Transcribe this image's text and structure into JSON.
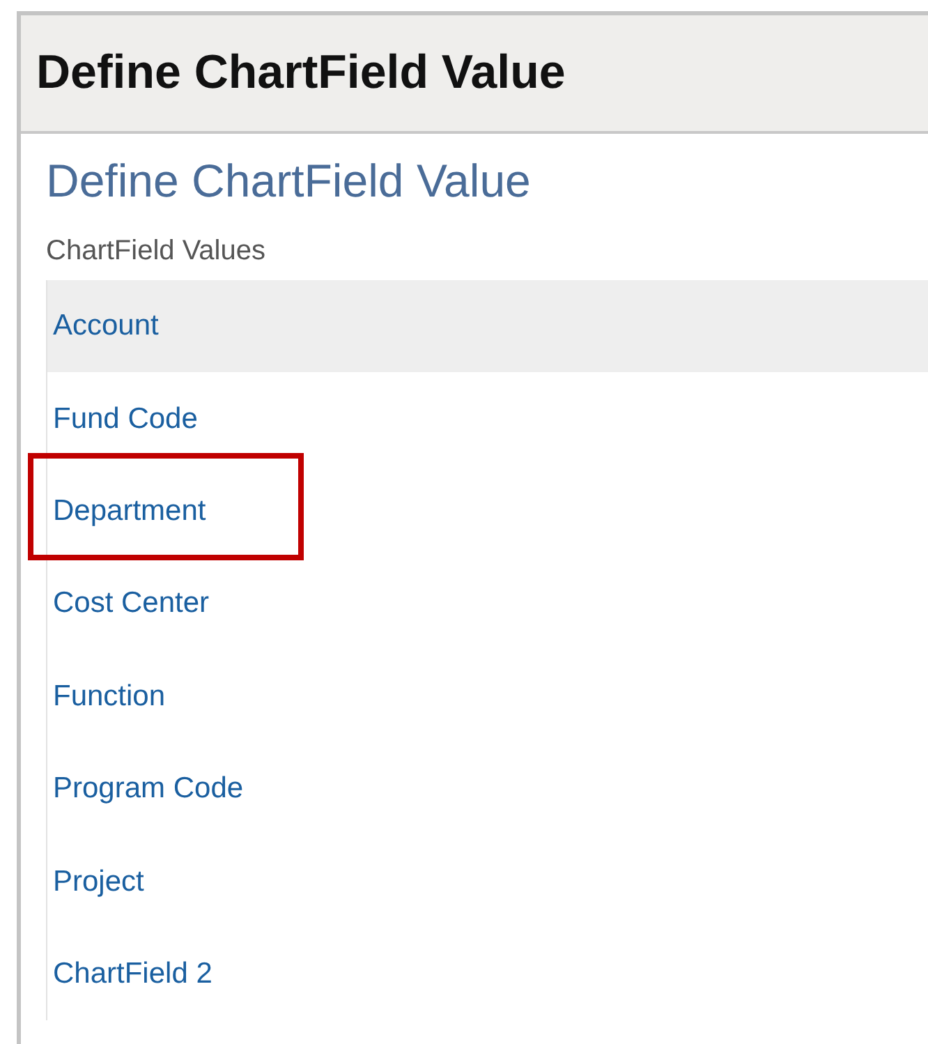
{
  "window": {
    "title": "Define ChartField Value"
  },
  "page": {
    "heading": "Define ChartField Value",
    "section_label": "ChartField Values"
  },
  "items": [
    {
      "label": "Account",
      "selected": true,
      "highlighted": false
    },
    {
      "label": "Fund Code",
      "selected": false,
      "highlighted": false
    },
    {
      "label": "Department",
      "selected": false,
      "highlighted": true
    },
    {
      "label": "Cost Center",
      "selected": false,
      "highlighted": false
    },
    {
      "label": "Function",
      "selected": false,
      "highlighted": false
    },
    {
      "label": "Program Code",
      "selected": false,
      "highlighted": false
    },
    {
      "label": "Project",
      "selected": false,
      "highlighted": false
    },
    {
      "label": "ChartField 2",
      "selected": false,
      "highlighted": false
    }
  ]
}
